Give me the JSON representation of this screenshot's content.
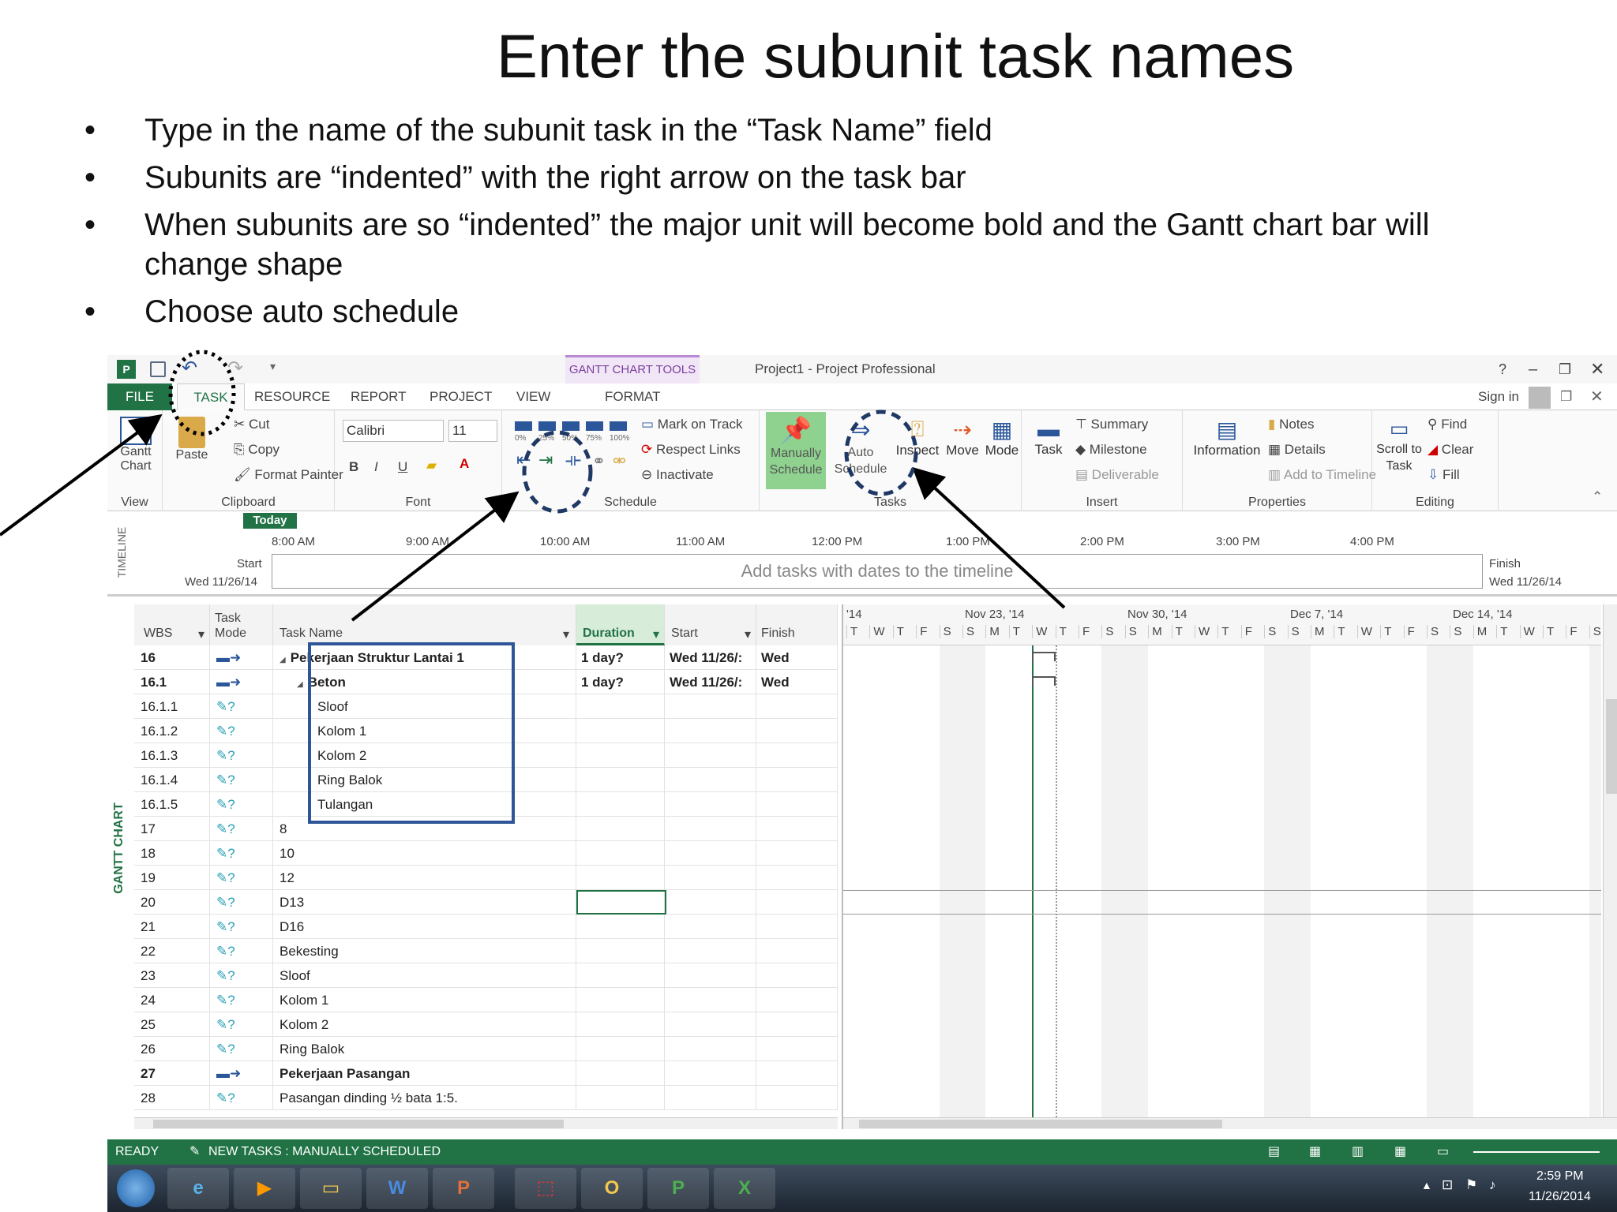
{
  "slide": {
    "title": "Enter the subunit task names",
    "bullets": [
      "Type in the name of the subunit task in the “Task Name” field",
      "Subunits are “indented” with the right arrow on the task bar",
      "When subunits are so “indented” the major unit will become bold and the Gantt chart bar will change shape",
      "Choose auto schedule"
    ]
  },
  "window": {
    "title": "Project1 - Project Professional",
    "context_tab": "GANTT CHART TOOLS",
    "help": "?",
    "sign_in": "Sign in"
  },
  "tabs": [
    "FILE",
    "TASK",
    "RESOURCE",
    "REPORT",
    "PROJECT",
    "VIEW",
    "FORMAT"
  ],
  "ribbon": {
    "view": {
      "label": "View",
      "gantt": "Gantt",
      "chart": "Chart"
    },
    "clipboard": {
      "label": "Clipboard",
      "paste": "Paste",
      "cut": "Cut",
      "copy": "Copy",
      "format_painter": "Format Painter"
    },
    "font": {
      "label": "Font",
      "font_name": "Calibri",
      "font_size": "11",
      "bold": "B",
      "italic": "I",
      "underline": "U"
    },
    "schedule": {
      "label": "Schedule",
      "pcts": [
        "0%",
        "25%",
        "50%",
        "75%",
        "100%"
      ],
      "mark_on_track": "Mark on Track",
      "respect_links": "Respect Links",
      "inactivate": "Inactivate"
    },
    "tasks": {
      "label": "Tasks",
      "manually_schedule": "Manually Schedule",
      "auto_schedule": "Auto Schedule",
      "inspect": "Inspect",
      "move": "Move",
      "mode": "Mode"
    },
    "insert": {
      "label": "Insert",
      "task": "Task",
      "summary": "Summary",
      "milestone": "Milestone",
      "deliverable": "Deliverable"
    },
    "properties": {
      "label": "Properties",
      "information": "Information",
      "notes": "Notes",
      "details": "Details",
      "add_to_timeline": "Add to Timeline"
    },
    "editing": {
      "label": "Editing",
      "scroll_to_task": "Scroll to Task",
      "find": "Find",
      "clear": "Clear",
      "fill": "Fill"
    }
  },
  "timeline": {
    "side_label": "TIMELINE",
    "today": "Today",
    "start_label": "Start",
    "start_date": "Wed 11/26/14",
    "finish_label": "Finish",
    "finish_date": "Wed 11/26/14",
    "placeholder": "Add tasks with dates to the timeline",
    "times": [
      "8:00 AM",
      "9:00 AM",
      "10:00 AM",
      "11:00 AM",
      "12:00 PM",
      "1:00 PM",
      "2:00 PM",
      "3:00 PM",
      "4:00 PM"
    ]
  },
  "grid": {
    "side_label": "GANTT CHART",
    "headers": {
      "wbs": "WBS",
      "mode_line1": "Task",
      "mode_line2": "Mode",
      "name": "Task Name",
      "duration": "Duration",
      "start": "Start",
      "finish": "Finish"
    },
    "rows": [
      {
        "id": "16",
        "wbs": "16",
        "name": "Pekerjaan Struktur Lantai 1",
        "duration": "1 day?",
        "start": "Wed 11/26/:",
        "finish": "Wed",
        "bold": true,
        "indent": 0,
        "collapse": "◢"
      },
      {
        "id": "17",
        "wbs": "16.1",
        "name": "Beton",
        "duration": "1 day?",
        "start": "Wed 11/26/:",
        "finish": "Wed",
        "bold": true,
        "indent": 1,
        "collapse": "◢"
      },
      {
        "id": "18",
        "wbs": "16.1.1",
        "name": "Sloof",
        "duration": "",
        "start": "",
        "finish": "",
        "bold": false,
        "indent": 2,
        "collapse": ""
      },
      {
        "id": "19",
        "wbs": "16.1.2",
        "name": "Kolom 1",
        "duration": "",
        "start": "",
        "finish": "",
        "bold": false,
        "indent": 2,
        "collapse": ""
      },
      {
        "id": "20",
        "wbs": "16.1.3",
        "name": "Kolom 2",
        "duration": "",
        "start": "",
        "finish": "",
        "bold": false,
        "indent": 2,
        "collapse": ""
      },
      {
        "id": "21",
        "wbs": "16.1.4",
        "name": "Ring Balok",
        "duration": "",
        "start": "",
        "finish": "",
        "bold": false,
        "indent": 2,
        "collapse": ""
      },
      {
        "id": "22",
        "wbs": "16.1.5",
        "name": "Tulangan",
        "duration": "",
        "start": "",
        "finish": "",
        "bold": false,
        "indent": 2,
        "collapse": ""
      },
      {
        "id": "23",
        "wbs": "17",
        "name": "8",
        "duration": "",
        "start": "",
        "finish": "",
        "bold": false,
        "indent": 0,
        "collapse": ""
      },
      {
        "id": "24",
        "wbs": "18",
        "name": "10",
        "duration": "",
        "start": "",
        "finish": "",
        "bold": false,
        "indent": 0,
        "collapse": ""
      },
      {
        "id": "25",
        "wbs": "19",
        "name": "12",
        "duration": "",
        "start": "",
        "finish": "",
        "bold": false,
        "indent": 0,
        "collapse": ""
      },
      {
        "id": "26",
        "wbs": "20",
        "name": "D13",
        "duration": "",
        "start": "",
        "finish": "",
        "bold": false,
        "indent": 0,
        "collapse": ""
      },
      {
        "id": "27",
        "wbs": "21",
        "name": "D16",
        "duration": "",
        "start": "",
        "finish": "",
        "bold": false,
        "indent": 0,
        "collapse": ""
      },
      {
        "id": "28",
        "wbs": "22",
        "name": "Bekesting",
        "duration": "",
        "start": "",
        "finish": "",
        "bold": false,
        "indent": 0,
        "collapse": ""
      },
      {
        "id": "29",
        "wbs": "23",
        "name": "Sloof",
        "duration": "",
        "start": "",
        "finish": "",
        "bold": false,
        "indent": 0,
        "collapse": ""
      },
      {
        "id": "30",
        "wbs": "24",
        "name": "Kolom 1",
        "duration": "",
        "start": "",
        "finish": "",
        "bold": false,
        "indent": 0,
        "collapse": ""
      },
      {
        "id": "31",
        "wbs": "25",
        "name": "Kolom 2",
        "duration": "",
        "start": "",
        "finish": "",
        "bold": false,
        "indent": 0,
        "collapse": ""
      },
      {
        "id": "32",
        "wbs": "26",
        "name": "Ring Balok",
        "duration": "",
        "start": "",
        "finish": "",
        "bold": false,
        "indent": 0,
        "collapse": ""
      },
      {
        "id": "33",
        "wbs": "27",
        "name": "Pekerjaan Pasangan",
        "duration": "",
        "start": "",
        "finish": "",
        "bold": true,
        "indent": 0,
        "collapse": ""
      },
      {
        "id": "34",
        "wbs": "28",
        "name": "Pasangan dinding ½ bata 1:5.",
        "duration": "",
        "start": "",
        "finish": "",
        "bold": false,
        "indent": 0,
        "collapse": ""
      }
    ]
  },
  "gantt": {
    "weeks": [
      "'14",
      "Nov 23, '14",
      "Nov 30, '14",
      "Dec 7, '14",
      "Dec 14, '14"
    ],
    "days": [
      "T",
      "W",
      "T",
      "F",
      "S",
      "S",
      "M",
      "T",
      "W",
      "T",
      "F",
      "S",
      "S",
      "M",
      "T",
      "W",
      "T",
      "F",
      "S",
      "S",
      "M",
      "T",
      "W",
      "T",
      "F",
      "S",
      "S",
      "M",
      "T",
      "W",
      "T",
      "F",
      "S"
    ]
  },
  "status": {
    "ready": "READY",
    "new_tasks": "NEW TASKS : MANUALLY SCHEDULED"
  },
  "taskbar": {
    "time": "2:59 PM",
    "date": "11/26/2014"
  },
  "colors": {
    "excel_green": "#217346",
    "accent_blue": "#2b579a",
    "annotation": "#1f3864"
  }
}
